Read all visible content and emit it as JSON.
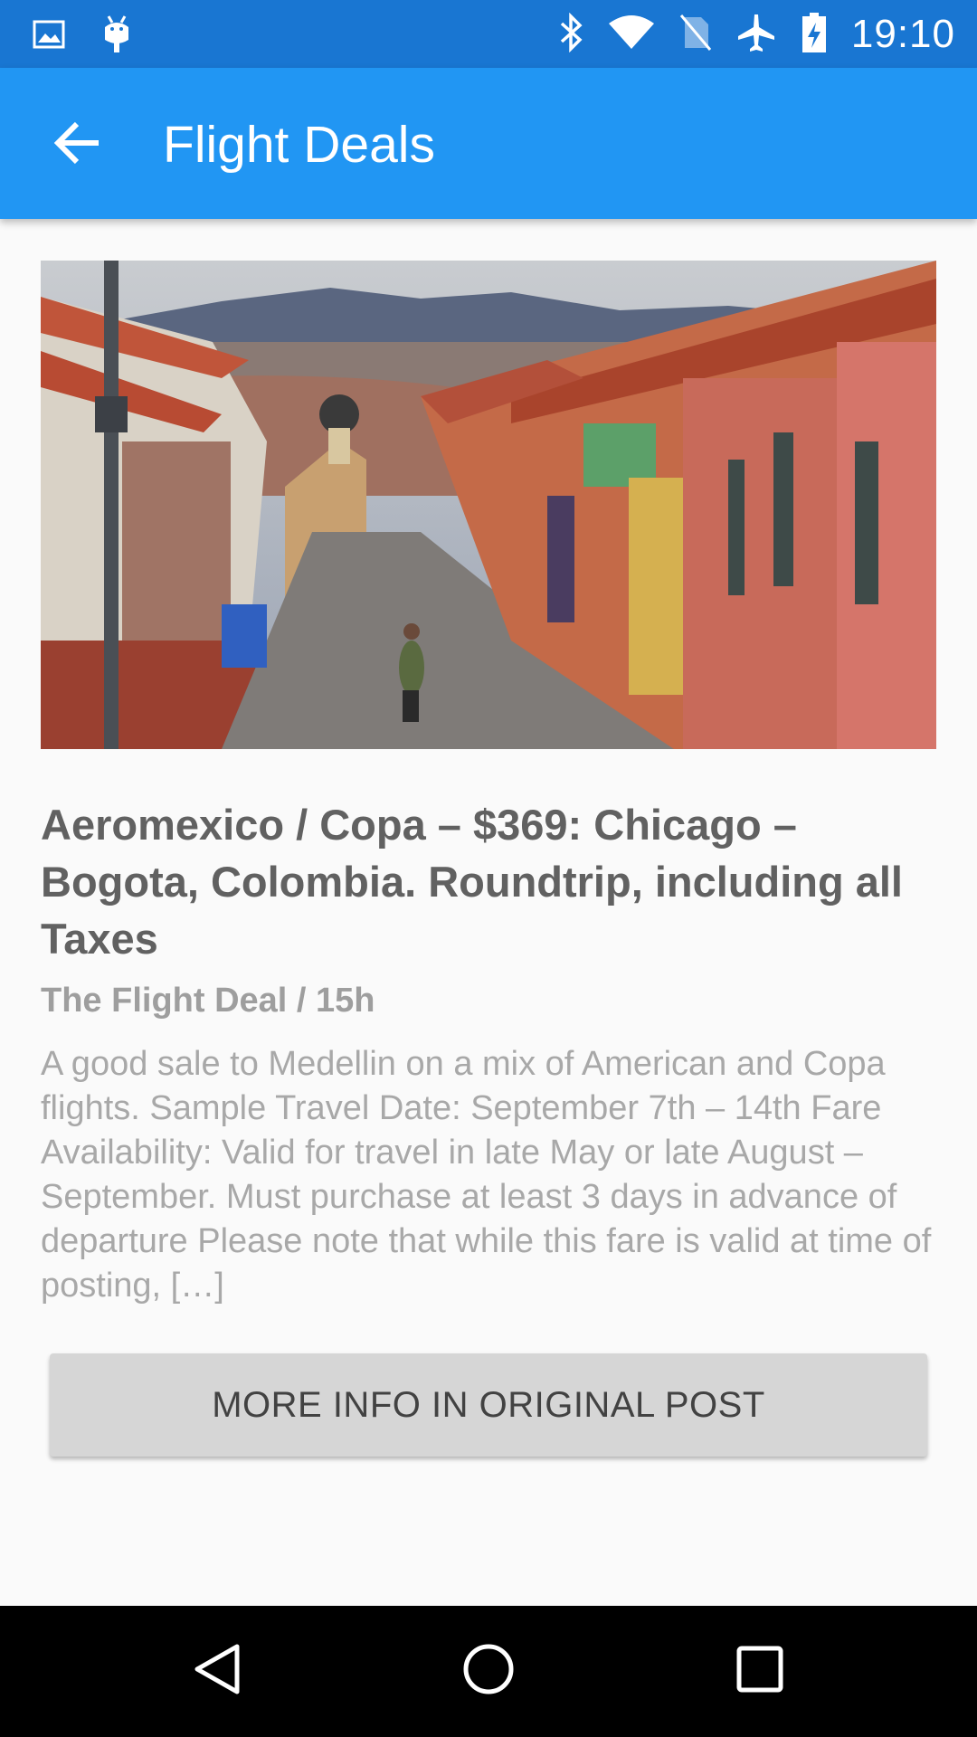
{
  "status_bar": {
    "time": "19:10",
    "left_icons": [
      "image-icon",
      "android-debug-icon"
    ],
    "right_icons": [
      "bluetooth-icon",
      "wifi-icon",
      "no-sim-icon",
      "airplane-mode-icon",
      "battery-charging-icon"
    ]
  },
  "app_bar": {
    "title": "Flight Deals",
    "back_icon": "arrow-back-icon",
    "color": "#2196f3",
    "status_color": "#1976d2"
  },
  "article": {
    "image_description": "Colorful colonial street in Bogota with red-tiled roofs and mountains",
    "headline": "Aeromexico / Copa – $369: Chicago – Bogota, Colombia. Roundtrip, including all Taxes",
    "meta": "The Flight Deal / 15h",
    "excerpt": "A good sale to Medellin on a mix of American and Copa flights. Sample Travel Date: September 7th – 14th Fare Availability: Valid for travel in late May or late August – September. Must purchase at least 3 days in advance of departure Please note that while this fare is valid at time of posting, […]",
    "button_label": "MORE INFO IN ORIGINAL POST"
  },
  "nav_bar": {
    "icons": [
      "back-triangle-icon",
      "home-circle-icon",
      "recents-square-icon"
    ]
  }
}
